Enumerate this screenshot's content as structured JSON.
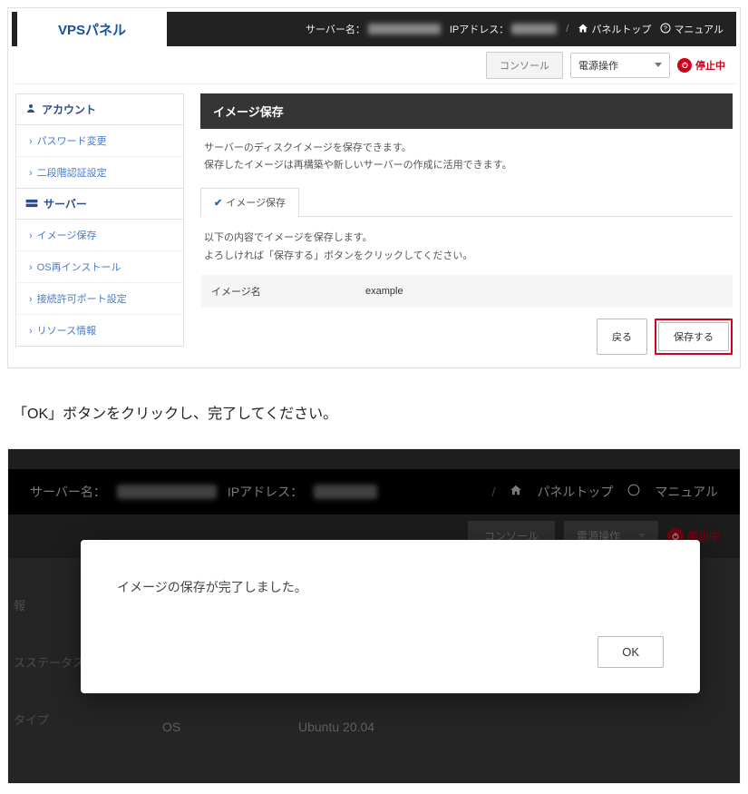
{
  "header": {
    "logo": "VPSパネル",
    "server_name_label": "サーバー名：",
    "ip_label": "IPアドレス：",
    "panel_top": "パネルトップ",
    "manual": "マニュアル"
  },
  "subheader": {
    "console": "コンソール",
    "power_select": "電源操作",
    "status_stopped": "停止中"
  },
  "sidebar": {
    "account_heading": "アカウント",
    "account_items": [
      "パスワード変更",
      "二段階認証設定"
    ],
    "server_heading": "サーバー",
    "server_items": [
      "イメージ保存",
      "OS再インストール",
      "接続許可ポート設定",
      "リソース情報"
    ]
  },
  "main": {
    "title": "イメージ保存",
    "desc_line1": "サーバーのディスクイメージを保存できます。",
    "desc_line2": "保存したイメージは再構築や新しいサーバーの作成に活用できます。",
    "tab_label": "イメージ保存",
    "confirm_line1": "以下の内容でイメージを保存します。",
    "confirm_line2": "よろしければ「保存する」ボタンをクリックしてください。",
    "field_label": "イメージ名",
    "field_value": "example",
    "btn_back": "戻る",
    "btn_save": "保存する"
  },
  "instruction": "「OK」ボタンをクリックし、完了してください。",
  "shot2": {
    "server_name_label": "サーバー名：",
    "ip_label": "IPアドレス：",
    "panel_top": "パネルトップ",
    "manual": "マニュアル",
    "console": "コンソール",
    "power_select": "電源操作",
    "status_stopped": "停止中",
    "side1": "報",
    "side2": "スステータス",
    "side3": "タイプ",
    "row_os_label": "OS",
    "row_os_value": "Ubuntu 20.04"
  },
  "modal": {
    "message": "イメージの保存が完了しました。",
    "ok": "OK"
  }
}
